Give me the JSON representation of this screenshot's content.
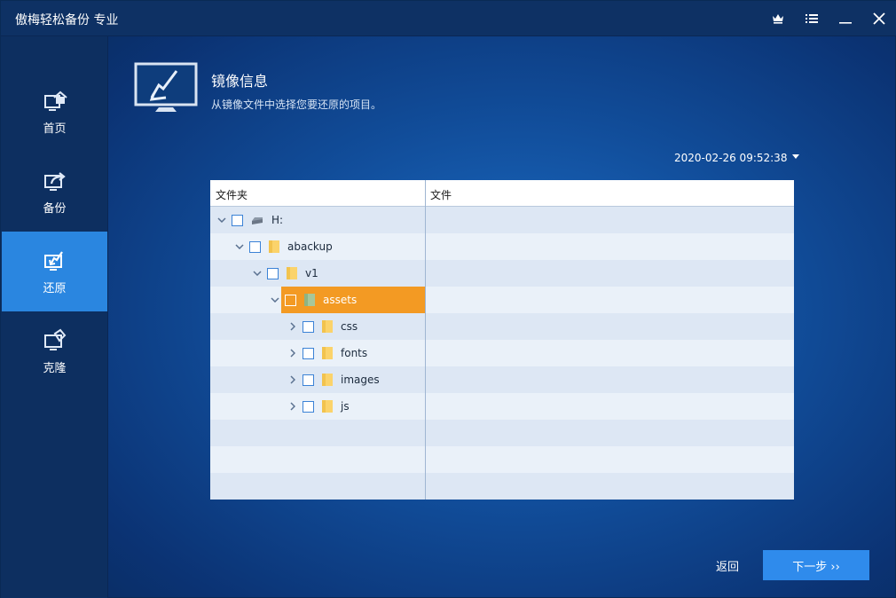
{
  "app": {
    "title": "傲梅轻松备份 专业",
    "titlebar_icons": [
      "crown-icon",
      "menu-list-icon",
      "minimize-icon",
      "close-icon"
    ]
  },
  "sidebar": {
    "items": [
      {
        "label": "首页",
        "icon": "home-monitor-icon",
        "active": false
      },
      {
        "label": "备份",
        "icon": "backup-monitor-icon",
        "active": false
      },
      {
        "label": "还原",
        "icon": "restore-monitor-icon",
        "active": true
      },
      {
        "label": "克隆",
        "icon": "clone-monitor-icon",
        "active": false
      }
    ]
  },
  "header": {
    "title": "镜像信息",
    "subtitle": "从镜像文件中选择您要还原的项目。",
    "icon": "restore-monitor-icon"
  },
  "date_select": {
    "value": "2020-02-26 09:52:38"
  },
  "table": {
    "columns": [
      "文件夹",
      "文件"
    ],
    "tree": [
      {
        "label": "H:",
        "icon": "drive-icon",
        "expanded": true,
        "selected": false
      },
      {
        "label": "abackup",
        "icon": "folder-icon",
        "expanded": true,
        "selected": false
      },
      {
        "label": "v1",
        "icon": "folder-icon",
        "expanded": true,
        "selected": false
      },
      {
        "label": "assets",
        "icon": "folder-icon",
        "expanded": true,
        "selected": true
      },
      {
        "label": "css",
        "icon": "folder-icon",
        "expanded": false,
        "selected": false
      },
      {
        "label": "fonts",
        "icon": "folder-icon",
        "expanded": false,
        "selected": false
      },
      {
        "label": "images",
        "icon": "folder-icon",
        "expanded": false,
        "selected": false
      },
      {
        "label": "js",
        "icon": "folder-icon",
        "expanded": false,
        "selected": false
      }
    ]
  },
  "footer": {
    "back_label": "返回",
    "next_label": "下一步 ››"
  },
  "colors": {
    "accent": "#2f8bec",
    "active_nav": "#2a86e0",
    "selected_row": "#f39a23",
    "titlebar": "#0e3164"
  }
}
